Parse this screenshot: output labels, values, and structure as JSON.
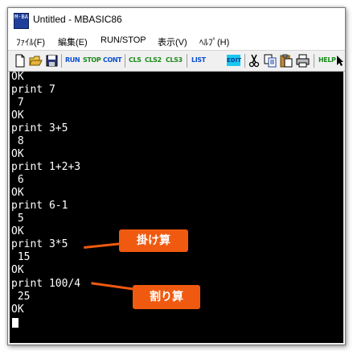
{
  "window": {
    "title": "Untitled - MBASIC86",
    "icon_label": "M-BA"
  },
  "menu": {
    "items": [
      "ﾌｧｲﾙ(F)",
      "編集(E)",
      "RUN/STOP",
      "表示(V)",
      "ﾍﾙﾌﾟ(H)"
    ]
  },
  "toolbar": {
    "run": "RUN",
    "stop": "STOP",
    "cont": "CONT",
    "cls": "CLS",
    "cls2": "CLS2",
    "cls3": "CLS3",
    "list": "LIST",
    "edit": "EDIT",
    "help": "HELP"
  },
  "terminal": {
    "lines": [
      "OK",
      "print 7",
      " 7",
      "OK",
      "print 3+5",
      " 8",
      "OK",
      "print 1+2+3",
      " 6",
      "OK",
      "print 6-1",
      " 5",
      "OK",
      "print 3*5",
      " 15",
      "OK",
      "print 100/4",
      " 25",
      "OK"
    ]
  },
  "annotations": {
    "multiply": "掛け算",
    "divide": "割り算"
  },
  "colors": {
    "terminal_bg": "#000000",
    "terminal_fg": "#ffffff",
    "callout": "#ef5a10",
    "toolbar_blue": "#0a4fd0",
    "toolbar_green": "#1a8a1a",
    "edit_bg": "#1ac8ef"
  }
}
